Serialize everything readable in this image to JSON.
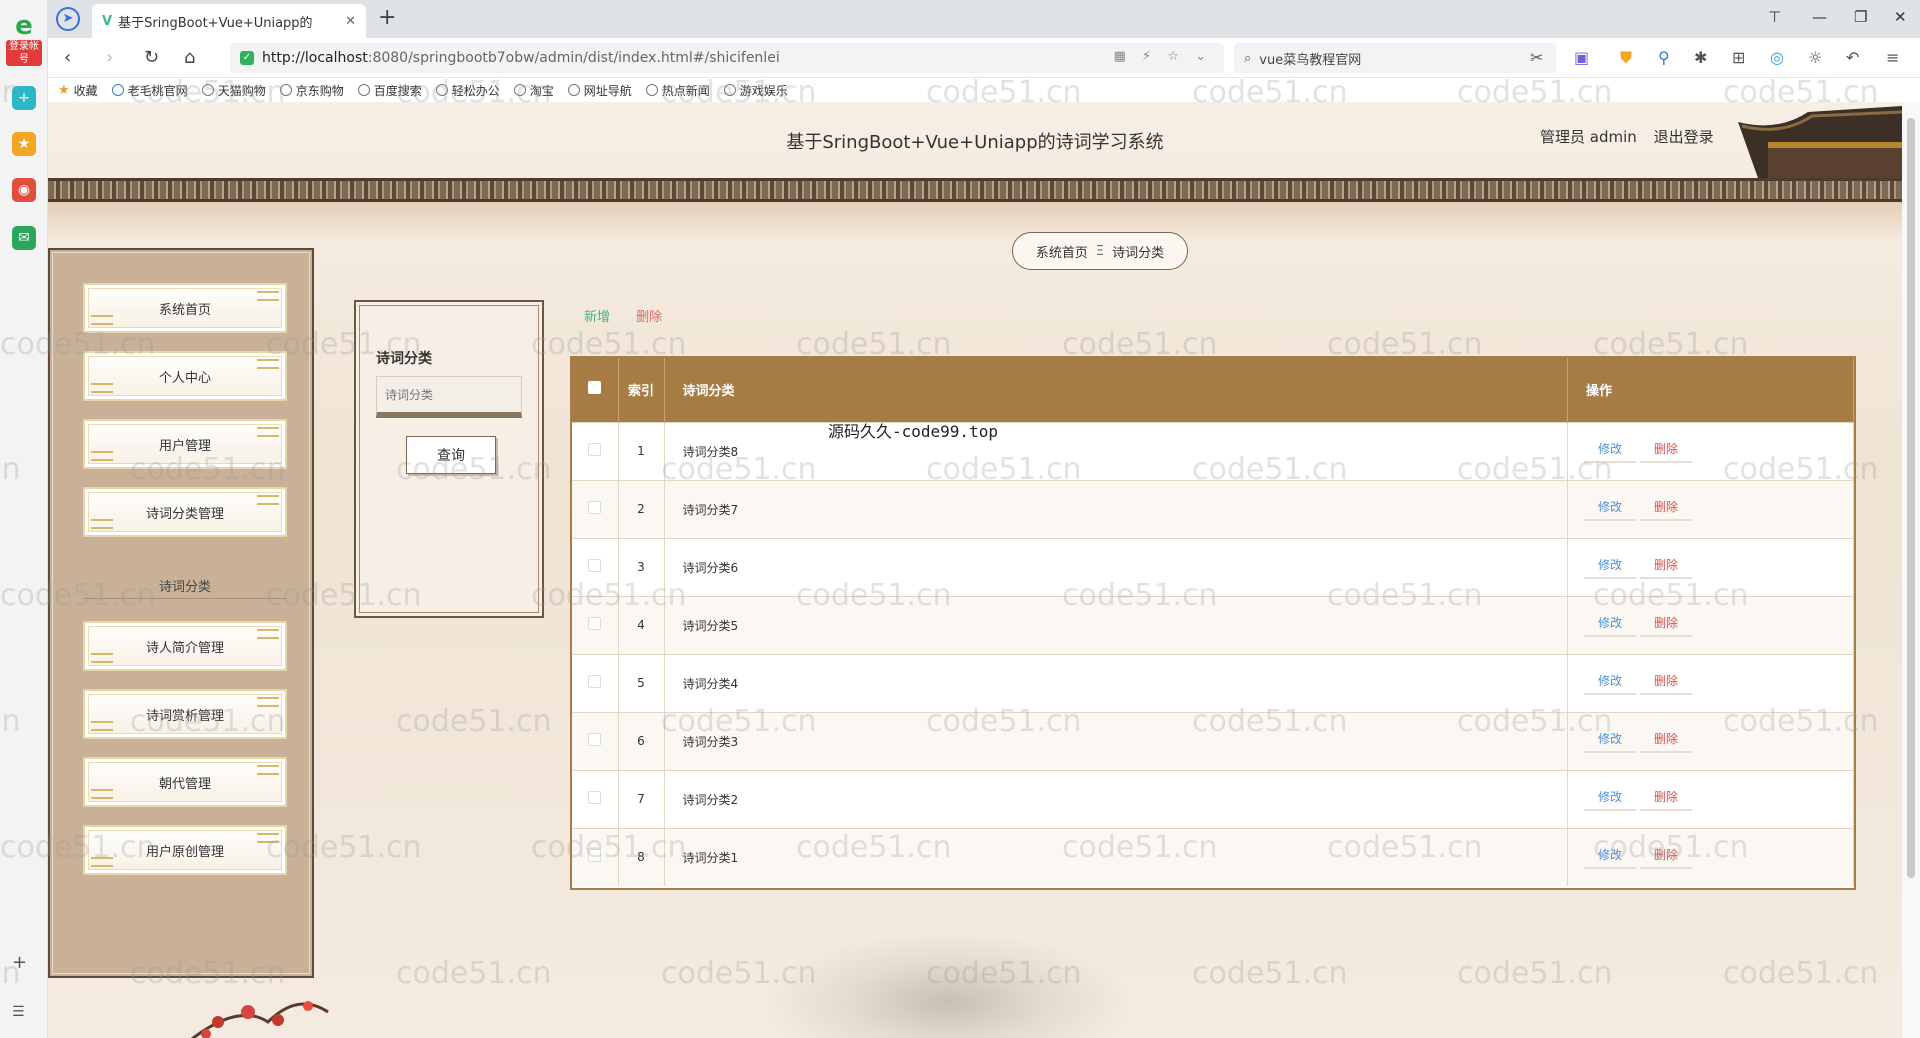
{
  "browser": {
    "side_tag": "登录帐号",
    "tab_title": "基于SringBoot+Vue+Uniapp的",
    "url_host": "http://localhost",
    "url_rest": ":8080/springbootb7obw/admin/dist/index.html#/shicifenlei",
    "search_text": "vue菜鸟教程官网",
    "bookmarks": [
      "收藏",
      "老毛桃官网",
      "天猫购物",
      "京东购物",
      "百度搜索",
      "轻松办公",
      "淘宝",
      "网址导航",
      "热点新闻",
      "游戏娱乐"
    ]
  },
  "header": {
    "title": "基于SringBoot+Vue+Uniapp的诗词学习系统",
    "user_label": "管理员 admin",
    "logout": "退出登录"
  },
  "breadcrumb": {
    "home": "系统首页",
    "sep": "Ξ",
    "current": "诗词分类"
  },
  "menu": {
    "items": [
      "系统首页",
      "个人中心",
      "用户管理",
      "诗词分类管理"
    ],
    "sub": "诗词分类",
    "items2": [
      "诗人简介管理",
      "诗词赏析管理",
      "朝代管理",
      "用户原创管理"
    ]
  },
  "search_panel": {
    "label": "诗词分类",
    "placeholder": "诗词分类",
    "button": "查询"
  },
  "actions": {
    "add": "新增",
    "delete": "删除"
  },
  "table": {
    "headers": {
      "index": "索引",
      "name": "诗词分类",
      "op": "操作"
    },
    "rows": [
      {
        "index": "1",
        "name": "诗词分类8"
      },
      {
        "index": "2",
        "name": "诗词分类7"
      },
      {
        "index": "3",
        "name": "诗词分类6"
      },
      {
        "index": "4",
        "name": "诗词分类5"
      },
      {
        "index": "5",
        "name": "诗词分类4"
      },
      {
        "index": "6",
        "name": "诗词分类3"
      },
      {
        "index": "7",
        "name": "诗词分类2"
      },
      {
        "index": "8",
        "name": "诗词分类1"
      }
    ],
    "edit": "修改",
    "remove": "删除"
  },
  "overlay_text": "源码久久-code99.top",
  "watermark": "code51.cn"
}
